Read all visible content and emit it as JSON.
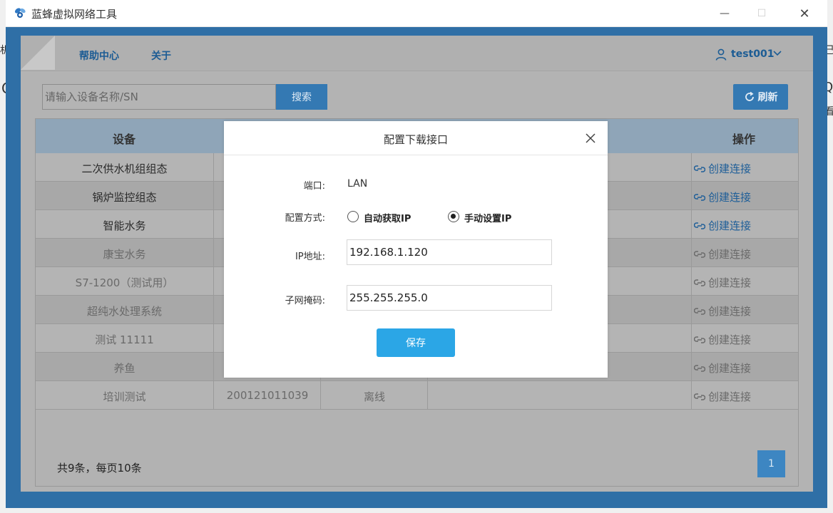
{
  "window": {
    "title": "蓝蜂虚拟网络工具",
    "min_symbol": "—",
    "max_symbol": "☐",
    "close_symbol": "✕",
    "bg_fragments": [
      "机",
      "己",
      "C",
      "Q",
      "看"
    ]
  },
  "nav": {
    "items": [
      "帮助中心",
      "关于"
    ],
    "user": "test001"
  },
  "toolbar": {
    "search_placeholder": "请输入设备名称/SN",
    "search_label": "搜索",
    "refresh_label": "刷新"
  },
  "table": {
    "headers": {
      "device": "设备",
      "action": "操作"
    },
    "rows": [
      {
        "name": "二次供水机组组态",
        "sn": "",
        "status": "",
        "action": "创建连接",
        "online": true
      },
      {
        "name": "锅炉监控组态",
        "sn": "",
        "status": "",
        "action": "创建连接",
        "online": true
      },
      {
        "name": "智能水务",
        "sn": "",
        "status": "",
        "action": "创建连接",
        "online": true
      },
      {
        "name": "康宝水务",
        "sn": "",
        "status": "",
        "action": "创建连接",
        "online": false
      },
      {
        "name": "S7-1200（测试用）",
        "sn": "",
        "status": "",
        "action": "创建连接",
        "online": false
      },
      {
        "name": "超纯水处理系统",
        "sn": "",
        "status": "",
        "action": "创建连接",
        "online": false
      },
      {
        "name": "测试 11111",
        "sn": "",
        "status": "",
        "action": "创建连接",
        "online": false
      },
      {
        "name": "养鱼",
        "sn": "",
        "status": "",
        "action": "创建连接",
        "online": false
      },
      {
        "name": "培训测试",
        "sn": "200121011039",
        "status": "离线",
        "action": "创建连接",
        "online": false
      }
    ]
  },
  "pagination": {
    "summary": "共9条，每页10条",
    "current_page": "1"
  },
  "modal": {
    "title": "配置下载接口",
    "port_label": "端口:",
    "port_value": "LAN",
    "mode_label": "配置方式:",
    "mode_auto": "自动获取IP",
    "mode_manual": "手动设置IP",
    "selected_mode": "manual",
    "ip_label": "IP地址:",
    "ip_value": "192.168.1.120",
    "mask_label": "子网掩码:",
    "mask_value": "255.255.255.0",
    "save_label": "保存"
  },
  "colors": {
    "frame": "#2f6fa6",
    "overlay": "#b3b3b3",
    "primary_button": "#2ba6e6",
    "link_text": "#1c5c94"
  }
}
